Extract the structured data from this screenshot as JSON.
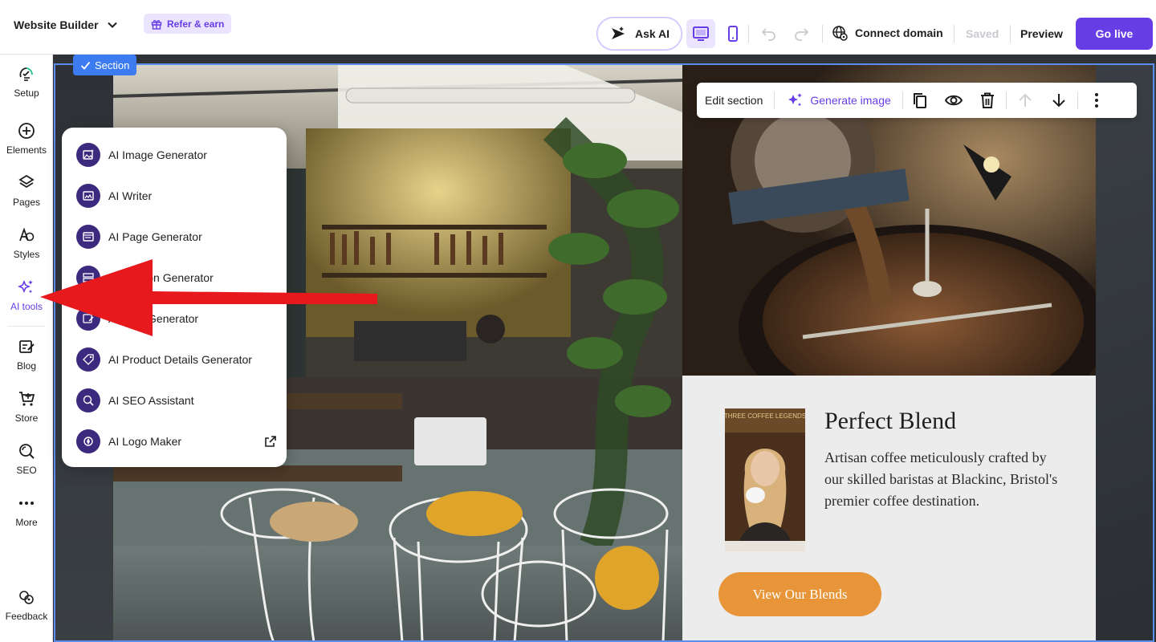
{
  "topbar": {
    "title": "Website Builder",
    "refer_label": "Refer & earn",
    "ask_ai_label": "Ask AI",
    "connect_label": "Connect domain",
    "saved_label": "Saved",
    "preview_label": "Preview",
    "golive_label": "Go live"
  },
  "sidebar": {
    "items": [
      {
        "label": "Setup",
        "icon": "setup-icon"
      },
      {
        "label": "Elements",
        "icon": "plus-circle-icon"
      },
      {
        "label": "Pages",
        "icon": "layers-icon"
      },
      {
        "label": "Styles",
        "icon": "styles-icon"
      },
      {
        "label": "AI tools",
        "icon": "sparkles-icon"
      },
      {
        "label": "Blog",
        "icon": "blog-icon"
      },
      {
        "label": "Store",
        "icon": "cart-icon"
      },
      {
        "label": "SEO",
        "icon": "seo-icon"
      },
      {
        "label": "More",
        "icon": "more-dots-icon"
      },
      {
        "label": "Feedback",
        "icon": "feedback-icon"
      }
    ]
  },
  "section_tag": "Section",
  "section_toolbar": {
    "edit_label": "Edit section",
    "generate_label": "Generate image"
  },
  "ai_menu": {
    "items": [
      {
        "label": "AI Image Generator"
      },
      {
        "label": "AI Writer"
      },
      {
        "label": "AI Page Generator"
      },
      {
        "label": "AI Section Generator"
      },
      {
        "label": "AI Blog Generator"
      },
      {
        "label": "AI Product Details Generator"
      },
      {
        "label": "AI SEO Assistant"
      },
      {
        "label": "AI Logo Maker"
      }
    ]
  },
  "hero": {
    "heading": "Perfect Blend",
    "paragraph": "Artisan coffee meticulously crafted by our skilled baristas at Blackinc, Bristol's premier coffee destination.",
    "cta_label": "View Our Blends",
    "portrait_sign": "THREE COFFEE LEGENDS"
  },
  "colors": {
    "accent": "#673de6",
    "selection": "#3d7bf0",
    "cta": "#e8953a",
    "arrow": "#e8191c"
  }
}
